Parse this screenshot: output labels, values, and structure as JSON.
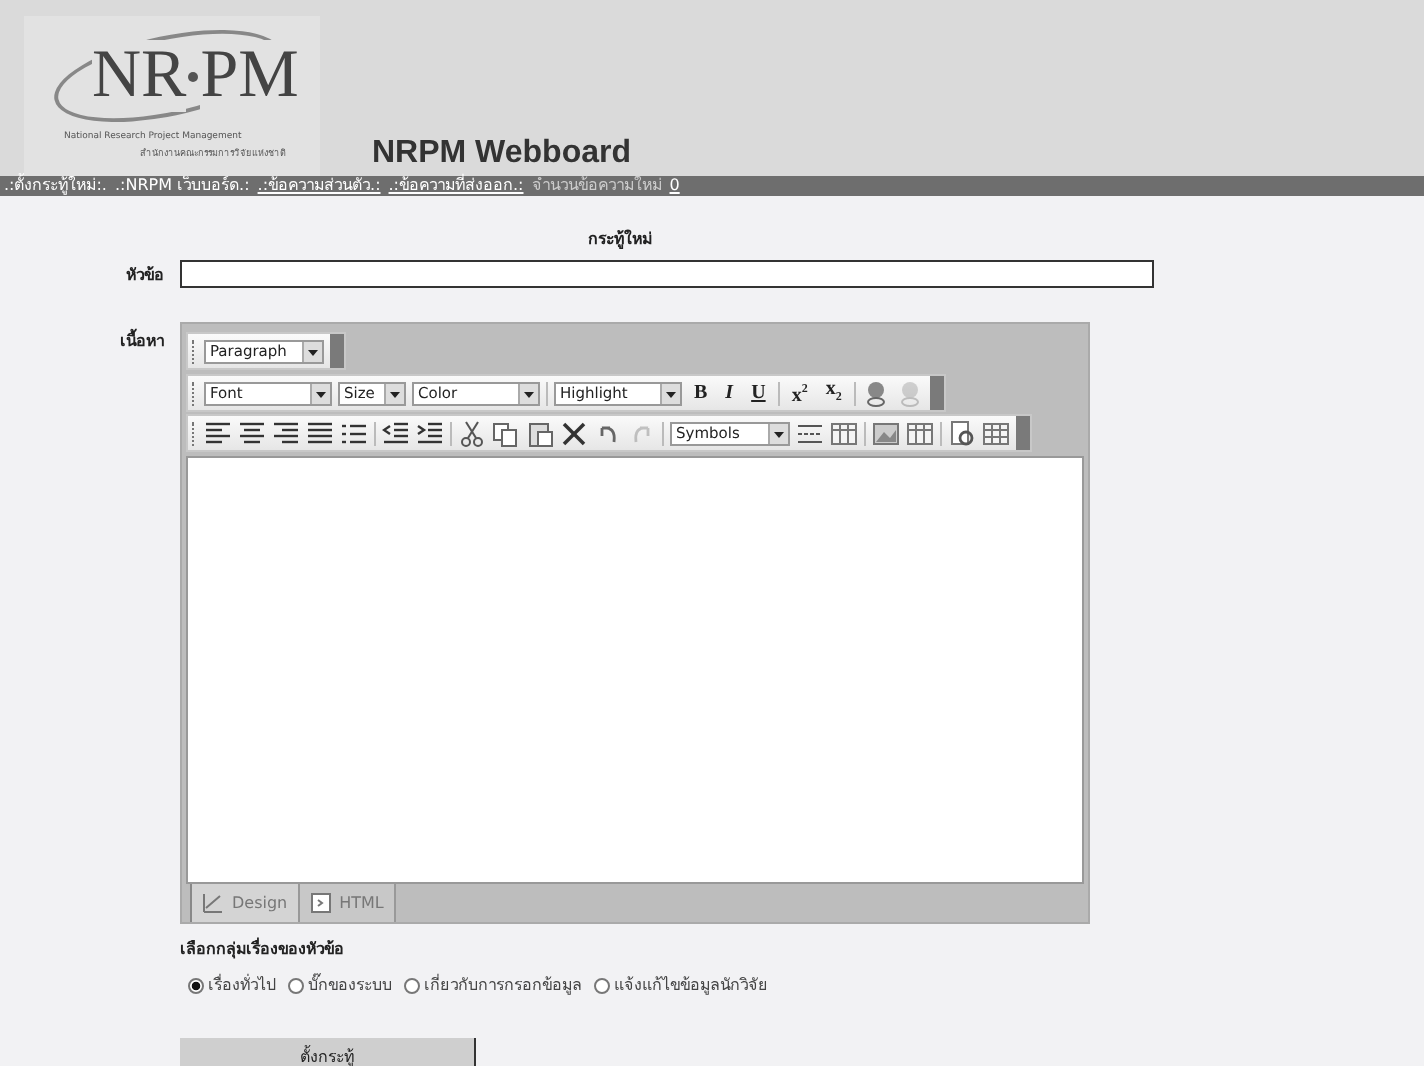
{
  "logo": {
    "mark_left": "NR",
    "mark_right": "PM",
    "subtitle": "National Research Project Management",
    "subtitle_thai": "สำนักงานคณะกรรมการวิจัยแห่งชาติ"
  },
  "site_title": "NRPM Webboard",
  "nav": [
    {
      "label": ".:ตั้งกระทู้ใหม่:.",
      "kind": "link"
    },
    {
      "label": ".:NRPM เว็บบอร์ด.:",
      "kind": "link"
    },
    {
      "label": ".:ข้อความส่วนตัว.:",
      "kind": "underlined"
    },
    {
      "label": ".:ข้อความที่ส่งออก.:",
      "kind": "underlined"
    },
    {
      "label": "จำนวนข้อความใหม่",
      "kind": "plain"
    },
    {
      "label": "0",
      "kind": "underlined"
    }
  ],
  "form_title": "กระทู้ใหม่",
  "subject": {
    "label": "หัวข้อ"
  },
  "body_label": "เนื้อหา",
  "toolbars": [
    [
      {
        "kind": "select",
        "label": "Paragraph"
      }
    ],
    [
      {
        "kind": "select",
        "label": "Font"
      },
      {
        "kind": "select",
        "label": "Size"
      },
      {
        "kind": "select",
        "label": "Color"
      },
      {
        "kind": "sep"
      },
      {
        "kind": "select",
        "label": "Highlight"
      },
      {
        "kind": "bold",
        "label": "B"
      },
      {
        "kind": "italic",
        "label": "I"
      },
      {
        "kind": "underline",
        "label": "U"
      },
      {
        "kind": "sep"
      },
      {
        "kind": "sup",
        "label": "x",
        "mark": "2"
      },
      {
        "kind": "sub",
        "label": "x",
        "mark": "2"
      },
      {
        "kind": "sep"
      },
      {
        "kind": "icon",
        "disabled": false
      },
      {
        "kind": "icon",
        "disabled": true
      }
    ],
    [
      {
        "kind": "icon",
        "disabled": false
      },
      {
        "kind": "icon",
        "disabled": false
      },
      {
        "kind": "icon",
        "disabled": false
      },
      {
        "kind": "icon",
        "disabled": false
      },
      {
        "kind": "icon",
        "disabled": false
      },
      {
        "kind": "sep"
      },
      {
        "kind": "icon",
        "disabled": false
      },
      {
        "kind": "icon",
        "disabled": false
      },
      {
        "kind": "sep"
      },
      {
        "kind": "icon",
        "disabled": false
      },
      {
        "kind": "icon",
        "disabled": false
      },
      {
        "kind": "icon",
        "disabled": false
      },
      {
        "kind": "icon",
        "disabled": false
      },
      {
        "kind": "icon",
        "disabled": false
      },
      {
        "kind": "icon",
        "disabled": true
      },
      {
        "kind": "sep"
      },
      {
        "kind": "select",
        "label": "Symbols"
      },
      {
        "kind": "icon",
        "disabled": false
      },
      {
        "kind": "icon",
        "disabled": false
      },
      {
        "kind": "sep"
      },
      {
        "kind": "icon",
        "disabled": false
      },
      {
        "kind": "icon",
        "disabled": false
      },
      {
        "kind": "sep"
      },
      {
        "kind": "icon",
        "disabled": false
      },
      {
        "kind": "icon",
        "disabled": false
      }
    ]
  ],
  "editor_tabs": [
    {
      "label": "Design",
      "selected": true
    },
    {
      "label": "HTML",
      "selected": false
    }
  ],
  "group_label": "เลือกกลุ่มเรื่องของหัวข้อ",
  "groups": [
    {
      "label": "เรื่องทั่วไป",
      "selected": true
    },
    {
      "label": "บั๊กของระบบ",
      "selected": false
    },
    {
      "label": "เกี่ยวกับการกรอกข้อมูล",
      "selected": false
    },
    {
      "label": "แจ้งแก้ไขข้อมูลนักวิจัย",
      "selected": false
    }
  ],
  "submit": "ตั้งกระทู้"
}
